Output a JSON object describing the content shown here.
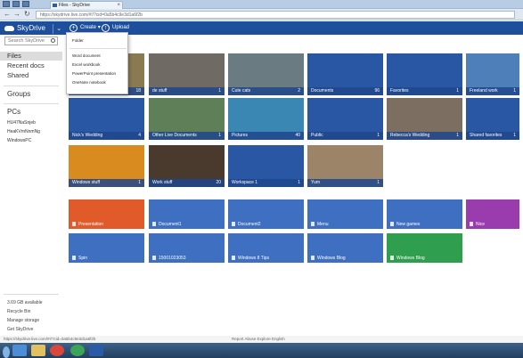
{
  "browser": {
    "tab_title": "Files - SkyDrive",
    "url": "https://skydrive.live.com/#!/?cid=0a5b4c9e3d1a6f2b"
  },
  "app": {
    "logo": "SkyDrive",
    "commands": {
      "create": "Create",
      "upload": "Upload"
    }
  },
  "create_menu": {
    "items": [
      "Folder",
      "Word document",
      "Excel workbook",
      "PowerPoint presentation",
      "OneNote notebook"
    ]
  },
  "sidebar": {
    "search_placeholder": "Search SkyDrive",
    "items": [
      "Files",
      "Recent docs",
      "Shared"
    ],
    "groups_label": "Groups",
    "pcs_label": "PCs",
    "pcs": [
      "HU47NaSnjeb",
      "HeaKVmNnmNg",
      "WindowsPC"
    ],
    "bottom_links": [
      "3.69 GB available",
      "Recycle Bin",
      "Manage storage",
      "Get SkyDrive"
    ]
  },
  "folders": [
    {
      "name": "",
      "count": "18",
      "color": "#8a7a52"
    },
    {
      "name": "de stuff",
      "count": "1",
      "color": "#6f6a63"
    },
    {
      "name": "Cute cats",
      "count": "2",
      "color": "#6a7b82"
    },
    {
      "name": "Documents",
      "count": "96",
      "color": "#2a57a3"
    },
    {
      "name": "Favorites",
      "count": "1",
      "color": "#2a57a3"
    },
    {
      "name": "Freeland work",
      "count": "1",
      "color": "#4f7fb8"
    },
    {
      "name": "Nick's Wedding",
      "count": "4",
      "color": "#2a57a3"
    },
    {
      "name": "Other Live Documents",
      "count": "1",
      "color": "#5e7f58"
    },
    {
      "name": "Pictures",
      "count": "40",
      "color": "#3b87b3"
    },
    {
      "name": "Public",
      "count": "1",
      "color": "#2a57a3"
    },
    {
      "name": "Rebecca's Wedding",
      "count": "1",
      "color": "#7c6f62"
    },
    {
      "name": "Shared favorites",
      "count": "1",
      "color": "#2a57a3"
    },
    {
      "name": "Windows stuff",
      "count": "1",
      "color": "#d98b20"
    },
    {
      "name": "Work stuff",
      "count": "20",
      "color": "#4a3a2e"
    },
    {
      "name": "Workspace 1",
      "count": "1",
      "color": "#2a57a3"
    },
    {
      "name": "Yum",
      "count": "1",
      "color": "#9c8468"
    }
  ],
  "files": [
    {
      "name": "Presentation",
      "color": "#e05a2a"
    },
    {
      "name": "Document1",
      "color": "#3e6fc1"
    },
    {
      "name": "Document2",
      "color": "#3e6fc1"
    },
    {
      "name": "Menu",
      "color": "#3e6fc1"
    },
    {
      "name": "New games",
      "color": "#3e6fc1"
    },
    {
      "name": "Nice",
      "color": "#9b3cae"
    },
    {
      "name": "Spin",
      "color": "#3e6fc1"
    },
    {
      "name": "15001023053",
      "color": "#3e6fc1"
    },
    {
      "name": "Windows 8 Tips",
      "color": "#3e6fc1"
    },
    {
      "name": "Windows Blog",
      "color": "#3e6fc1"
    },
    {
      "name": "Windows Blog",
      "color": "#2f9e4f"
    }
  ],
  "status": {
    "left": "https://skydrive.live.com/#!/?cid=0a5b4c9e3d1a6f2b",
    "right": "Report Abuse   Explore   English"
  },
  "taskbar": {
    "apps": [
      "ie-icon",
      "explorer-icon",
      "chrome-icon",
      "phone-icon",
      "word-icon"
    ]
  }
}
